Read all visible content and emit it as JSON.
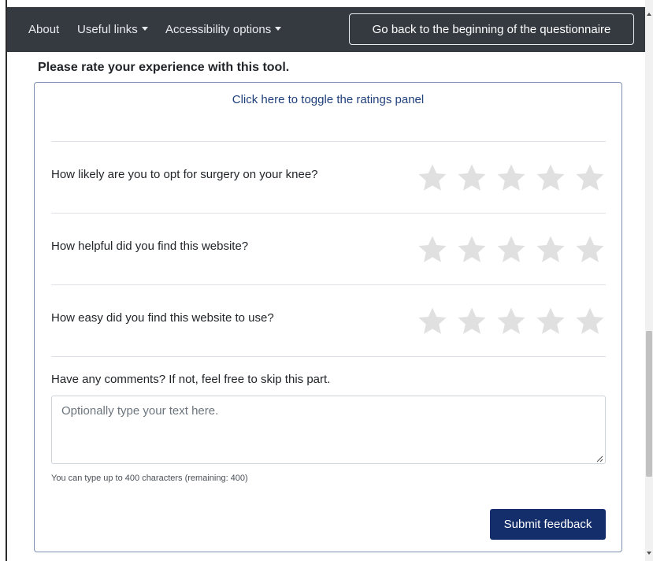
{
  "nav": {
    "about": "About",
    "useful_links": "Useful links",
    "accessibility": "Accessibility options",
    "back_button": "Go back to the beginning of the questionnaire"
  },
  "rating": {
    "title": "Please rate your experience with this tool.",
    "toggle": "Click here to toggle the ratings panel",
    "star_color": "#e0e0e0",
    "questions": [
      {
        "text": "How likely are you to opt for surgery on your knee?",
        "rating": 0,
        "max": 5
      },
      {
        "text": "How helpful did you find this website?",
        "rating": 0,
        "max": 5
      },
      {
        "text": "How easy did you find this website to use?",
        "rating": 0,
        "max": 5
      }
    ],
    "comments_label": "Have any comments? If not, feel free to skip this part.",
    "comments_placeholder": "Optionally type your text here.",
    "comments_value": "",
    "char_limit_text": "You can type up to 400 characters (remaining: 400)",
    "submit": "Submit feedback"
  },
  "colors": {
    "navbar": "#343a40",
    "submit_bg": "#142d6b",
    "toggle_link": "#1f3f7a"
  }
}
